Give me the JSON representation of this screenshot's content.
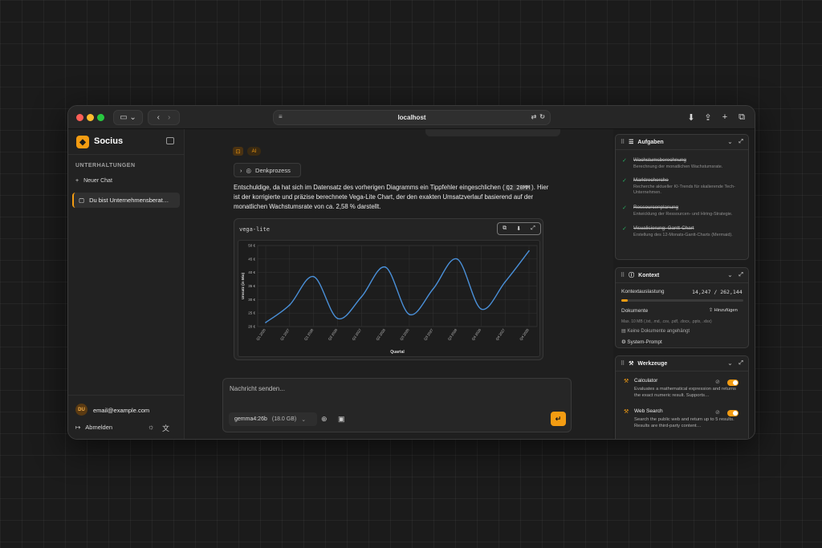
{
  "browser": {
    "url": "localhost"
  },
  "sidebar": {
    "app_name": "Socius",
    "section_title": "UNTERHALTUNGEN",
    "new_chat": "Neuer Chat",
    "chats": [
      "Du bist Unternehmensberat…"
    ],
    "user_initials": "DU",
    "user_email": "email@example.com",
    "logout": "Abmelden"
  },
  "chat": {
    "ai_badge": "AI",
    "thinking_label": "Denkprozess",
    "message_part1": "Entschuldige, da hat sich im Datensatz des vorherigen Diagramms ein Tippfehler eingeschlichen (",
    "message_code": "Q2 20MM",
    "message_part2": "). Hier ist der korrigierte und präzise berechnete Vega-Lite Chart, der den exakten Umsatzverlauf basierend auf der monatlichen Wachstumsrate von ca. 2,58 % darstellt.",
    "code_label": "vega-lite"
  },
  "chart_data": {
    "type": "line",
    "xlabel": "Quartal",
    "ylabel": "Umsatz (in Mio)",
    "categories": [
      "Q1 2026",
      "Q1 2027",
      "Q1 2028",
      "Q2 2026",
      "Q2 2027",
      "Q2 2028",
      "Q3 2026",
      "Q3 2027",
      "Q3 2028",
      "Q4 2026",
      "Q4 2027",
      "Q4 2028"
    ],
    "values": [
      21.5,
      28,
      38.5,
      23,
      31,
      42,
      24.5,
      34,
      45,
      26.5,
      36.5,
      48
    ],
    "yticks": [
      "20 €",
      "25 €",
      "30 €",
      "35 €",
      "40 €",
      "45 €",
      "50 €"
    ],
    "ylim": [
      20,
      50
    ],
    "color": "#4a90d9"
  },
  "composer": {
    "placeholder": "Nachricht senden...",
    "model": "gemma4:26b",
    "model_size": "(18.0 GB)"
  },
  "tasks": {
    "title": "Aufgaben",
    "items": [
      {
        "title": "Wachstumsberechnung",
        "desc": "Berechnung der monatlichen Wachstumsrate."
      },
      {
        "title": "Marktrecherche",
        "desc": "Recherche aktueller KI-Trends für skalierende Tech-Unternehmen."
      },
      {
        "title": "Ressourcenplanung",
        "desc": "Entwicklung der Ressourcen- und Hiring-Strategie."
      },
      {
        "title": "Visualisierung: Gantt-Chart",
        "desc": "Erstellung des 12-Monats-Gantt-Charts (Mermaid)."
      }
    ]
  },
  "context": {
    "title": "Kontext",
    "usage_label": "Kontextauslastung",
    "usage_value": "14,247 / 262,144",
    "usage_fraction": 0.054,
    "docs_label": "Dokumente",
    "add_label": "Hinzufügen",
    "max_info": "Max. 10 MB (.txt, .md, .csv, .pdf, .docx, .pptx, .xlsx)",
    "no_docs": "Keine Dokumente angehängt",
    "system_prompt": "System-Prompt"
  },
  "tools": {
    "title": "Werkzeuge",
    "items": [
      {
        "name": "Calculator",
        "desc": "Evaluates a mathematical expression and returns the exact numeric result. Supports…"
      },
      {
        "name": "Web Search",
        "desc": "Search the public web and return up to 5 results. Results are third-party content…"
      }
    ]
  }
}
